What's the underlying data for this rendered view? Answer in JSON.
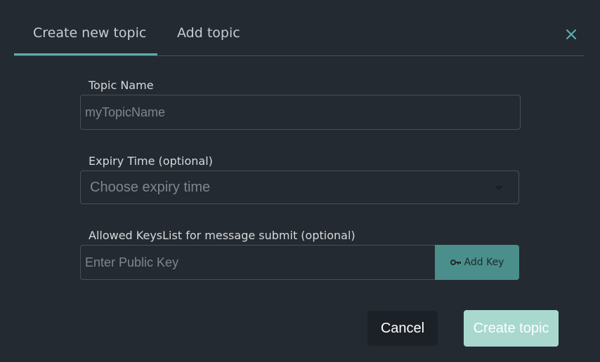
{
  "tabs": {
    "create_label": "Create new topic",
    "add_label": "Add topic",
    "active": "Create new topic"
  },
  "form": {
    "topic_name": {
      "label": "Topic Name",
      "placeholder": "myTopicName",
      "value": ""
    },
    "expiry": {
      "label": "Expiry Time (optional)",
      "selected": "Choose expiry time"
    },
    "keys": {
      "label": "Allowed KeysList for message submit (optional)",
      "placeholder": "Enter Public Key",
      "add_label": "Add Key"
    }
  },
  "actions": {
    "cancel_label": "Cancel",
    "create_label": "Create topic"
  },
  "colors": {
    "background": "#242a31",
    "accent": "#59aeab",
    "add_key_button": "#4a8f8b",
    "create_button": "#a9d8cf",
    "cancel_button": "#1c2127"
  },
  "icons": {
    "close": "close-icon",
    "key": "key-icon",
    "dropdown": "chevron-down-icon"
  }
}
